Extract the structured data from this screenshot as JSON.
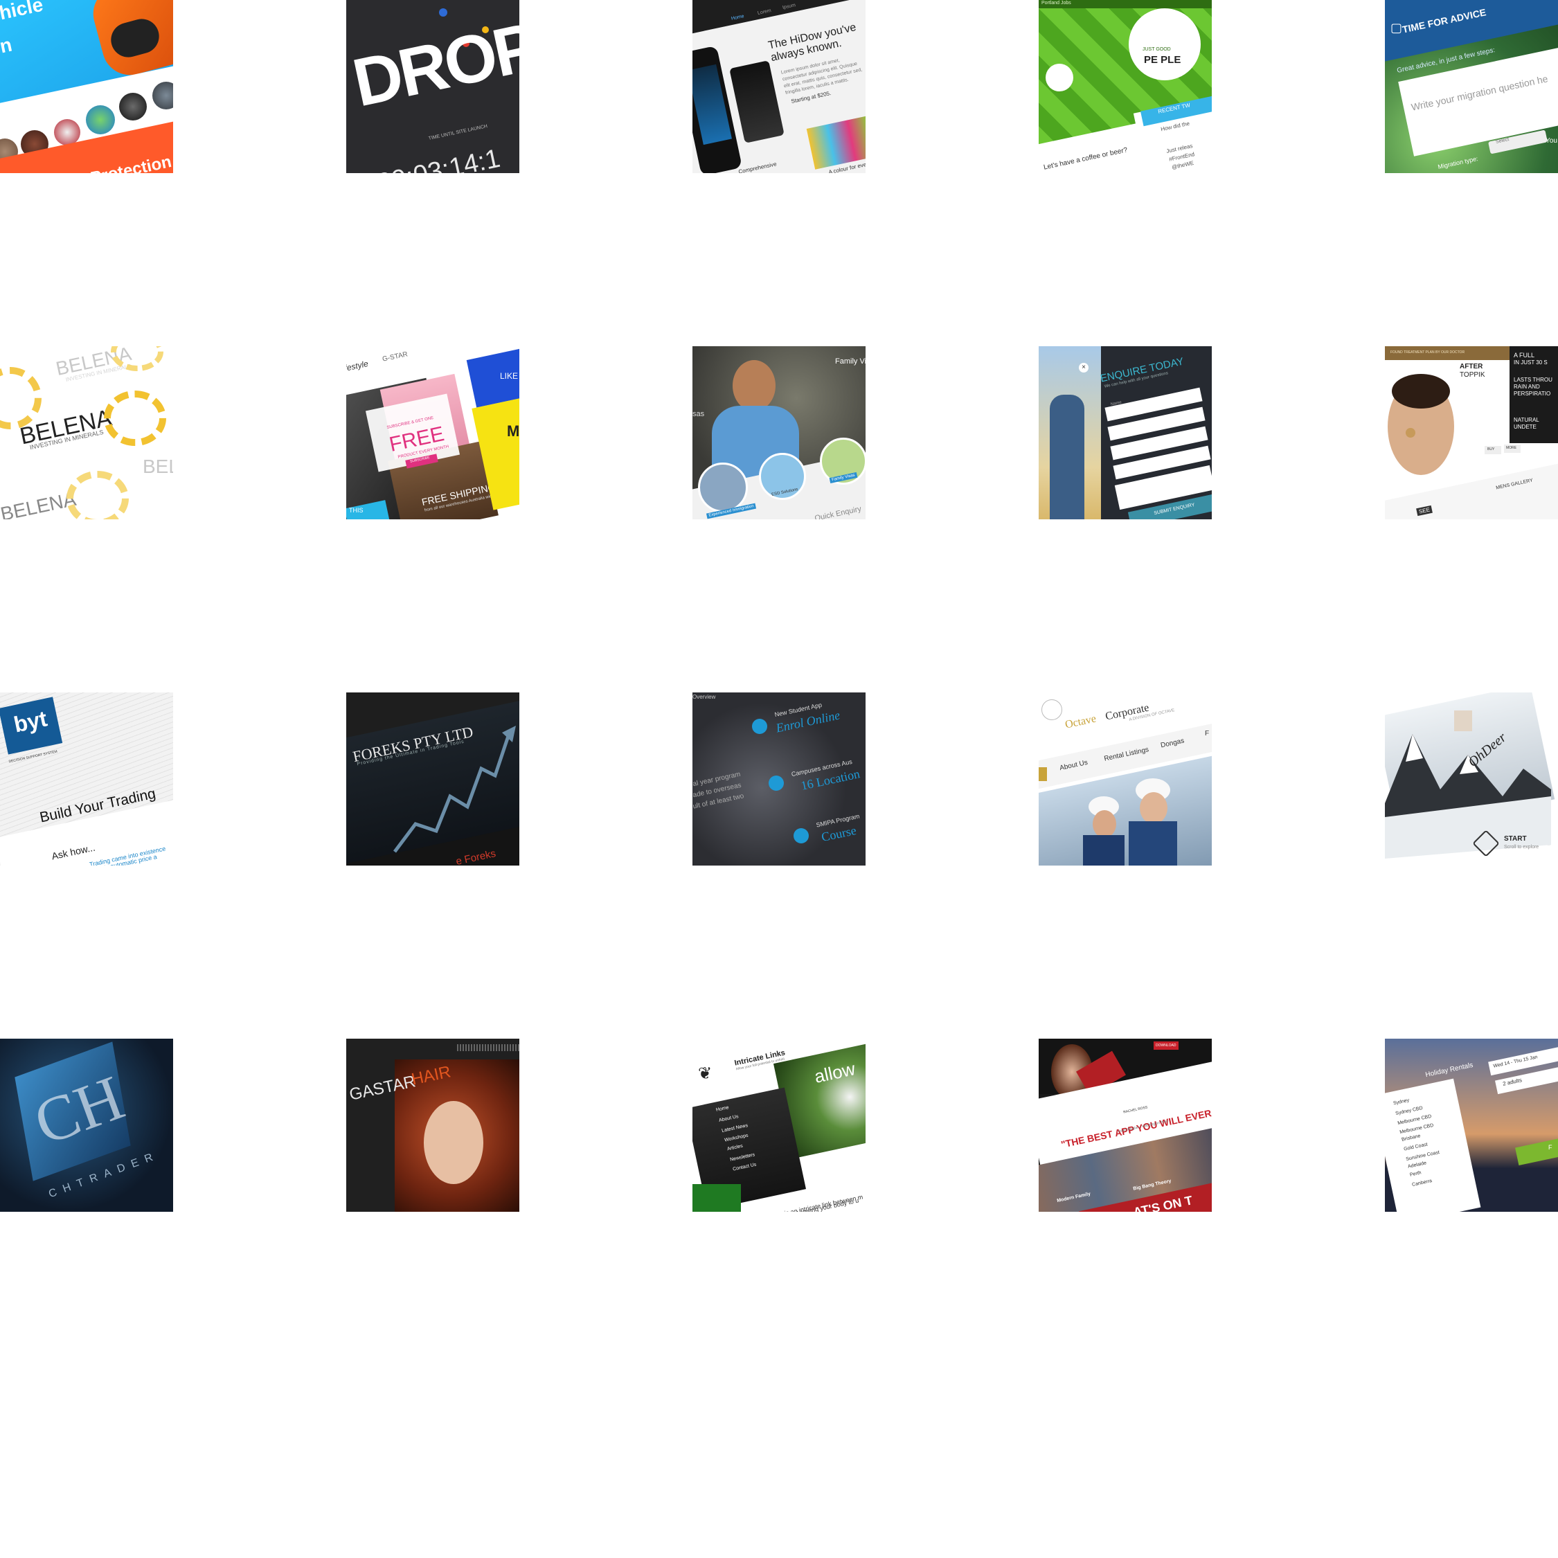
{
  "gallery": {
    "r1c1": {
      "line1": "hicle",
      "line2": "n",
      "banner": "Protection"
    },
    "r1c2": {
      "logo": "DROP",
      "caption": "TIME UNTIL SITE LAUNCH",
      "countdown": "09:03:14:1"
    },
    "r1c3": {
      "nav": [
        "Home",
        "Lorem",
        "Ipsum"
      ],
      "headline": "The HiDow you've always known.",
      "body": "Lorem ipsum dolor sit amet, consectetur adipiscing elit. Quisque elit erat, mattis quis, consectetur sed, fringilla lorem, iaculis a mattis.",
      "price": "Starting at $205.",
      "footer_left": "Comprehensive",
      "footer_right": "A colour for every"
    },
    "r1c4": {
      "topbar": "Portland Jobs",
      "logo_line1": "JUST GOOD",
      "logo_line2": "PE PLE",
      "coffee": "Let's have a coffee or beer?",
      "twitter": "RECENT TW",
      "tweet1": "How did the",
      "tweet2": "Just releas",
      "tweet3": "#FrontEnd",
      "tweet4": "@theWE"
    },
    "r1c5": {
      "title": "TIME FOR ADVICE",
      "subtitle": "Great advice, in just a few steps:",
      "placeholder": "Write your migration question he",
      "label": "Migration type:",
      "select": "Select",
      "extra": "You"
    },
    "r2c1": {
      "brand": "BELENA",
      "tagline": "INVESTING IN MINERALS"
    },
    "r2c2": {
      "brand_left": "lifestyle",
      "brand_right": "G-STAR",
      "promo_top": "SUBSCRIBE & GET ONE",
      "promo_big": "FREE",
      "promo_sub": "PRODUCT EVERY MONTH",
      "button": "SUBSCRIBE",
      "shipping": "FREE SHIPPING",
      "shipping_sub": "from all our warehouses Australia wide",
      "side_top": "LIKE O",
      "side_mid": "M",
      "side_bottom": "THIS"
    },
    "r2c3": {
      "nav": "Family Vi",
      "side": "sas",
      "c1": "Experienced Immigration",
      "c2": "ESD Solutions",
      "c3": "Family Visas",
      "enquiry": "Quick Enquiry"
    },
    "r2c4": {
      "title": "ENQUIRE TODAY",
      "subtitle": "We can help with all your questions",
      "fields": [
        "Name",
        "Email",
        "Phone",
        "Visa Type",
        "Message"
      ],
      "button": "SUBMIT ENQUIRY"
    },
    "r2c5": {
      "ribbon": "FOUND TREATMENT PLAN BY OUR DOCTOR",
      "after": "AFTER",
      "after_sub": "TOPPIK",
      "promo1": "A FULL",
      "promo2": "IN JUST 30 S",
      "promo3": "LASTS THROU",
      "promo4": "RAIN AND",
      "promo5": "PERSPIRATIO",
      "promo6": "NATURAL",
      "promo7": "UNDETE",
      "btn1": "BUY",
      "btn2": "MORE",
      "gallery_label": "MENS GALLERY",
      "see": "SEE"
    },
    "r3c1": {
      "logo": "byt",
      "logo_sub": "DECISION SUPPORT SYSTEM",
      "headline": "Build Your Trading",
      "ask": "Ask how...",
      "body1": "Trading came into existence",
      "body2": "'s automatic price a",
      "body3": "official inte"
    },
    "r3c2": {
      "title": "FOREKS PTY LTD",
      "subtitle": "Providing the Ultimate in Trading Tools",
      "footer": "e Foreks"
    },
    "r3c3": {
      "overview": "Overview",
      "item1_label": "New Student App",
      "item1_title": "Enrol Online",
      "item2_label": "Campuses across Aus",
      "item2_title": "16 Location",
      "item3_label": "SMIPA Program",
      "item3_title": "Course",
      "body1": "al year program",
      "body2": "ade to overseas",
      "body3": "ult of at least two"
    },
    "r3c4": {
      "brand": "Octave",
      "brand2": "Corporate",
      "tagline": "A DIVISION OF OCTAVE",
      "nav": [
        "About Us",
        "Rental Listings",
        "Dongas",
        "F"
      ]
    },
    "r3c5": {
      "logo": "OhDeer",
      "start": "START",
      "start_sub": "Scroll to explore"
    },
    "r4c1": {
      "brand": "CHTRADER",
      "mark": "CH"
    },
    "r4c2": {
      "brand_a": "GASTAR",
      "brand_b": "HAIR"
    },
    "r4c3": {
      "title": "Intricate Links",
      "subtitle": "Allow your full potential to unfold",
      "menu": [
        "Home",
        "About Us",
        "Latest News",
        "Workshops",
        "Articles",
        "Newsletters",
        "Contact Us"
      ],
      "hero": "allow",
      "body1": "There is an intricate link between m",
      "body2": "Allowing your body to u"
    },
    "r4c4": {
      "button": "DOWNLOAD",
      "byline": "RACHEL ROSS",
      "headline": "\"THE BEST APP YOU WILL EVER",
      "credit": "David Bluglan - Washington Post",
      "show1": "Modern Family",
      "show2": "Big Bang Theory",
      "footer": "AT'S ON T"
    },
    "r4c5": {
      "title": "Holiday Rentals",
      "dates": "Wed 14 - Thu 15 Jan",
      "nights": "1 night",
      "guests": "2 adults",
      "cities": [
        "Sydney",
        "Sydney CBD",
        "Melbourne CBD",
        "Melbourne CBD",
        "Brisbane",
        "Gold Coast",
        "Sunshine Coast",
        "Adelaide",
        "Perth",
        "Canberra"
      ],
      "go": "F"
    }
  }
}
